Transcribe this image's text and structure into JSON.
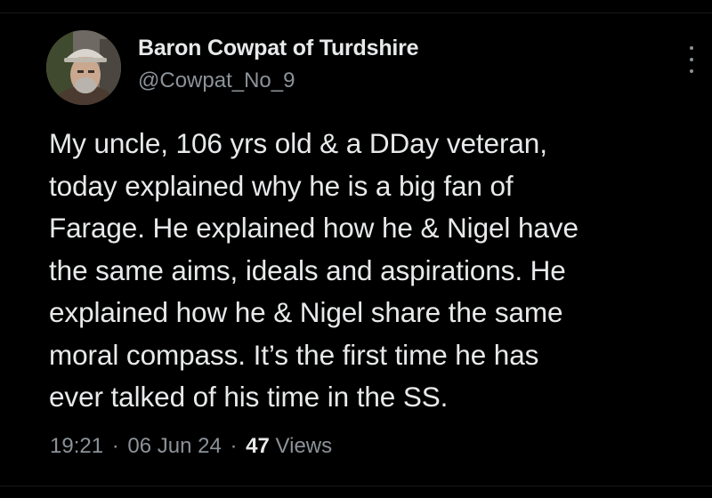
{
  "author": {
    "display_name": "Baron Cowpat of Turdshire",
    "handle": "@Cowpat_No_9",
    "avatar_icon": "profile-photo-avatar"
  },
  "tweet": {
    "lines": [
      "My uncle, 106 yrs old & a DDay veteran,",
      "today explained why he is a big fan of",
      "Farage. He explained how he & Nigel have",
      "the same aims, ideals and aspirations. He",
      "explained how he & Nigel share the same",
      "moral compass. It’s the first time he has",
      "ever talked of his time in the SS."
    ]
  },
  "meta": {
    "time": "19:21",
    "separator": "·",
    "date": "06 Jun 24",
    "views_count": "47",
    "views_label": "Views"
  },
  "icons": {
    "more": "more-vertical-icon"
  },
  "colors": {
    "background": "#000000",
    "text_primary": "#e7e9ea",
    "text_secondary": "#8b9298"
  }
}
